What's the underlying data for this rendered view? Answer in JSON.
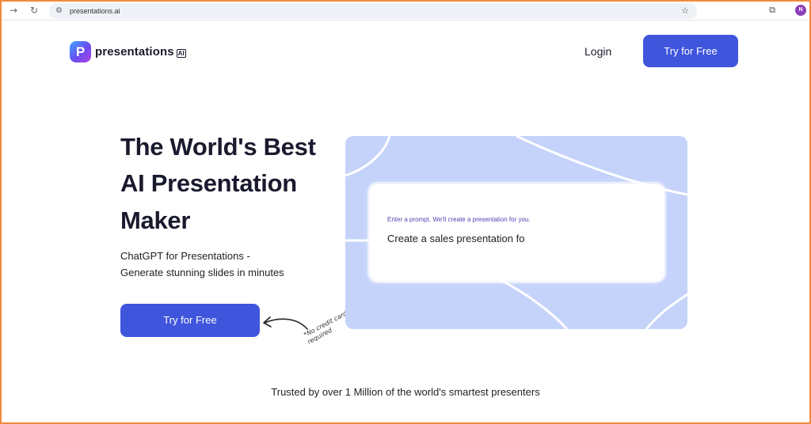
{
  "browser": {
    "url": "presentations.ai",
    "back_glyph": "→",
    "reload_glyph": "↻",
    "site_info_glyph": "⚙",
    "star_glyph": "☆",
    "ext_glyph": "⧉",
    "profile_initial": "N"
  },
  "header": {
    "logo_mark": "P",
    "logo_text": "presentations",
    "logo_ai": "AI",
    "login_label": "Login",
    "cta_label": "Try for Free"
  },
  "hero": {
    "line1": "The World's Best",
    "line2": "AI Presentation",
    "line3": "Maker",
    "subtitle_1": "ChatGPT for Presentations -",
    "subtitle_2": "Generate stunning slides in minutes",
    "cta_label": "Try for Free",
    "note": "*No credit card required"
  },
  "prompt": {
    "label": "Enter a prompt. We'll create a presentation for you.",
    "value": "Create a sales presentation fo"
  },
  "footer": {
    "trusted": "Trusted by over 1 Million of the world's smartest presenters"
  },
  "colors": {
    "accent": "#3f55dc",
    "panel": "#c5d3fb",
    "border": "#f08a3c",
    "text": "#1a1a2e"
  }
}
